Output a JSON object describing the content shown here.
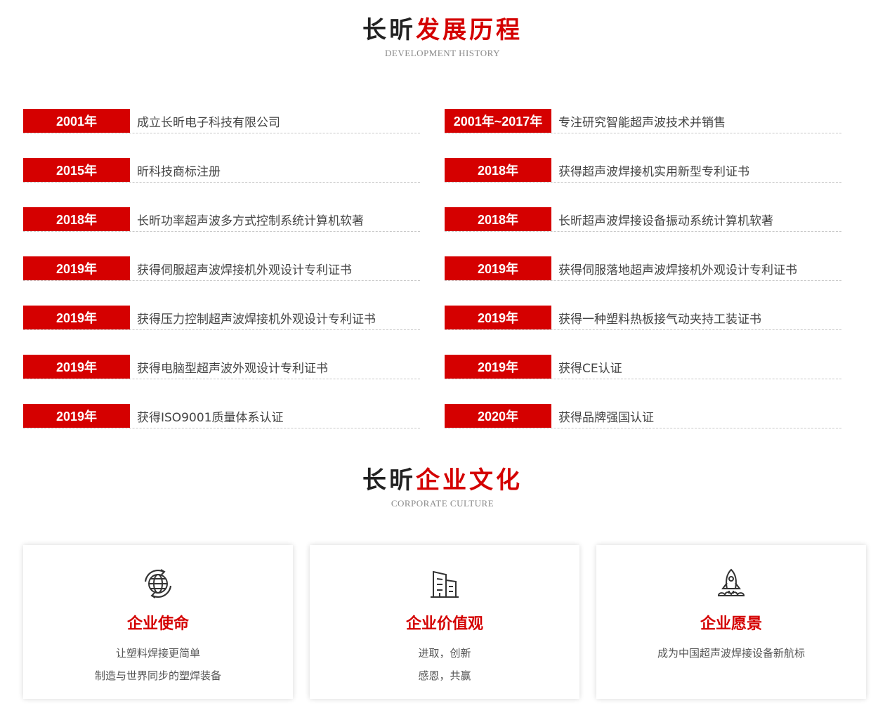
{
  "history": {
    "title_dark": "长昕",
    "title_red": "发展历程",
    "subtitle": "DEVELOPMENT HISTORY",
    "items": [
      {
        "year": "2001年",
        "text": "成立长昕电子科技有限公司"
      },
      {
        "year": "2001年~2017年",
        "text": "专注研究智能超声波技术并销售"
      },
      {
        "year": "2015年",
        "text": "昕科技商标注册"
      },
      {
        "year": "2018年",
        "text": "获得超声波焊接机实用新型专利证书"
      },
      {
        "year": "2018年",
        "text": "长昕功率超声波多方式控制系统计算机软著"
      },
      {
        "year": "2018年",
        "text": "长昕超声波焊接设备振动系统计算机软著"
      },
      {
        "year": "2019年",
        "text": "获得伺服超声波焊接机外观设计专利证书"
      },
      {
        "year": "2019年",
        "text": "获得伺服落地超声波焊接机外观设计专利证书"
      },
      {
        "year": "2019年",
        "text": "获得压力控制超声波焊接机外观设计专利证书"
      },
      {
        "year": "2019年",
        "text": "获得一种塑料热板接气动夹持工装证书"
      },
      {
        "year": "2019年",
        "text": "获得电脑型超声波外观设计专利证书"
      },
      {
        "year": "2019年",
        "text": "获得CE认证"
      },
      {
        "year": "2019年",
        "text": "获得ISO9001质量体系认证"
      },
      {
        "year": "2020年",
        "text": "获得品牌强国认证"
      }
    ]
  },
  "culture": {
    "title_dark": "长昕",
    "title_red": "企业文化",
    "subtitle": "CORPORATE CULTURE",
    "cards": [
      {
        "icon": "globe-icon",
        "title": "企业使命",
        "lines": [
          "让塑料焊接更简单",
          "制造与世界同步的塑焊装备"
        ]
      },
      {
        "icon": "buildings-icon",
        "title": "企业价值观",
        "lines": [
          "进取，创新",
          "感恩，共赢"
        ]
      },
      {
        "icon": "rocket-icon",
        "title": "企业愿景",
        "lines": [
          "成为中国超声波焊接设备新航标"
        ]
      }
    ]
  },
  "colors": {
    "accent": "#d50000",
    "text": "#444444",
    "subtitle": "#8a8a8a"
  }
}
